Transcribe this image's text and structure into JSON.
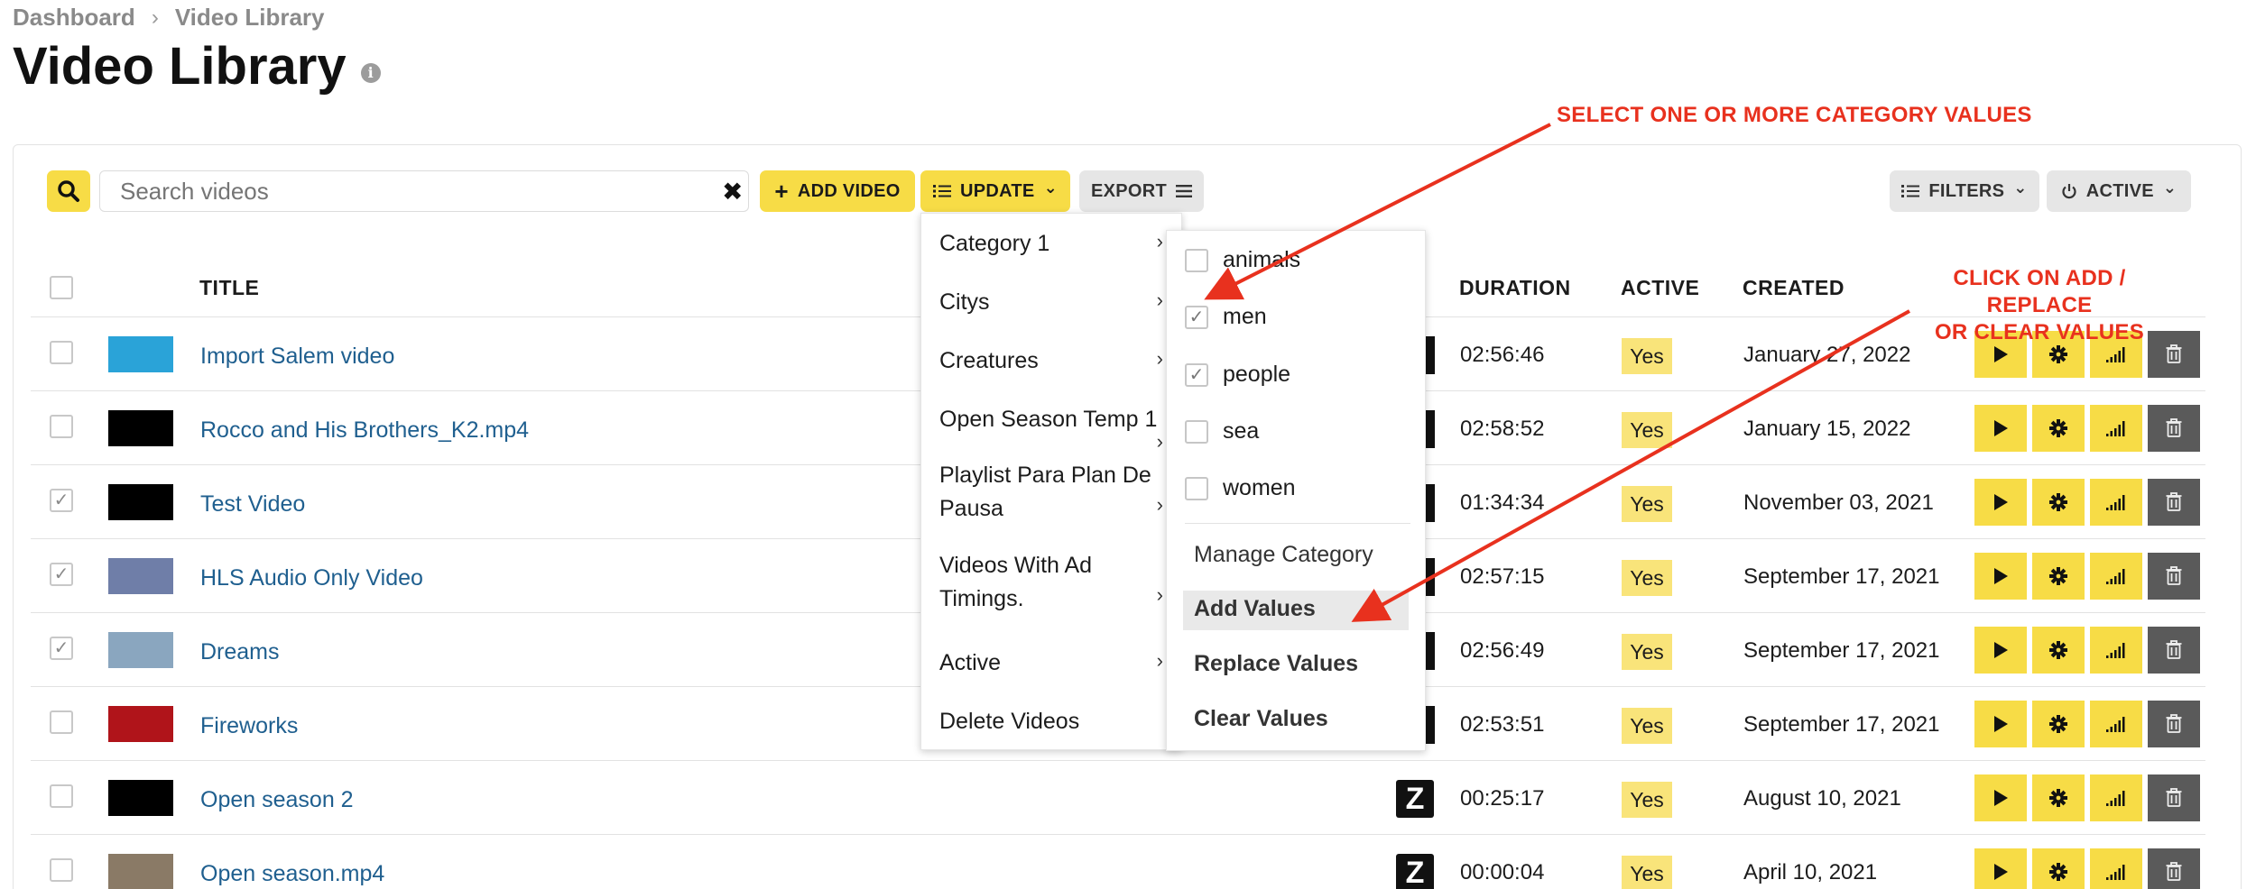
{
  "breadcrumb": {
    "home": "Dashboard",
    "separator": "›",
    "current": "Video Library"
  },
  "page": {
    "title": "Video Library",
    "info_icon": "i"
  },
  "toolbar": {
    "search_placeholder": "Search videos",
    "clear_icon": "✖",
    "add_video": "ADD VIDEO",
    "add_video_icon": "+",
    "update": "UPDATE",
    "export": "EXPORT",
    "filters": "FILTERS",
    "active": "ACTIVE",
    "caret": "⌄"
  },
  "table": {
    "headers": {
      "title": "TITLE",
      "duration": "DURATION",
      "active": "ACTIVE",
      "created": "CREATED"
    },
    "rows": [
      {
        "title": "Import Salem video",
        "duration": "02:56:46",
        "active": "Yes",
        "created": "January 27, 2022",
        "checked": false,
        "thumb": "#2aa3d8"
      },
      {
        "title": "Rocco and His Brothers_K2.mp4",
        "duration": "02:58:52",
        "active": "Yes",
        "created": "January 15, 2022",
        "checked": false,
        "thumb": "#000000"
      },
      {
        "title": "Test Video",
        "duration": "01:34:34",
        "active": "Yes",
        "created": "November 03, 2021",
        "checked": true,
        "thumb": "#000000"
      },
      {
        "title": "HLS Audio Only Video",
        "duration": "02:57:15",
        "active": "Yes",
        "created": "September 17, 2021",
        "checked": true,
        "thumb": "#6f7ea8"
      },
      {
        "title": "Dreams",
        "duration": "02:56:49",
        "active": "Yes",
        "created": "September 17, 2021",
        "checked": true,
        "thumb": "#8aa6bf"
      },
      {
        "title": "Fireworks",
        "duration": "02:53:51",
        "active": "Yes",
        "created": "September 17, 2021",
        "checked": false,
        "thumb": "#b0141a"
      },
      {
        "title": "Open season 2",
        "duration": "00:25:17",
        "active": "Yes",
        "created": "August 10, 2021",
        "checked": false,
        "thumb": "#000000"
      },
      {
        "title": "Open season.mp4",
        "duration": "00:00:04",
        "active": "Yes",
        "created": "April 10, 2021",
        "checked": false,
        "thumb": "#8a7a66"
      }
    ]
  },
  "update_menu": {
    "items": [
      {
        "label": "Category 1"
      },
      {
        "label": "Citys"
      },
      {
        "label": "Creatures"
      },
      {
        "label": "Open Season Temp 1"
      },
      {
        "label": "Playlist Para Plan De Pausa"
      },
      {
        "label": "Videos With Ad Timings."
      },
      {
        "label": "Active"
      },
      {
        "label": "Delete Videos"
      }
    ]
  },
  "category_submenu": {
    "values": [
      {
        "label": "animals",
        "checked": false
      },
      {
        "label": "men",
        "checked": true
      },
      {
        "label": "people",
        "checked": true
      },
      {
        "label": "sea",
        "checked": false
      },
      {
        "label": "women",
        "checked": false
      }
    ],
    "manage": "Manage Category",
    "add": "Add Values",
    "replace": "Replace Values",
    "clear": "Clear Values"
  },
  "annotations": {
    "select": "SELECT ONE OR MORE CATEGORY VALUES",
    "click_line1": "CLICK ON ADD / REPLACE",
    "click_line2": "OR CLEAR VALUES"
  },
  "colors": {
    "accent": "#f7dc46",
    "link": "#1f5f8f",
    "annotation": "#e8311e",
    "delete": "#5a5a5a"
  }
}
